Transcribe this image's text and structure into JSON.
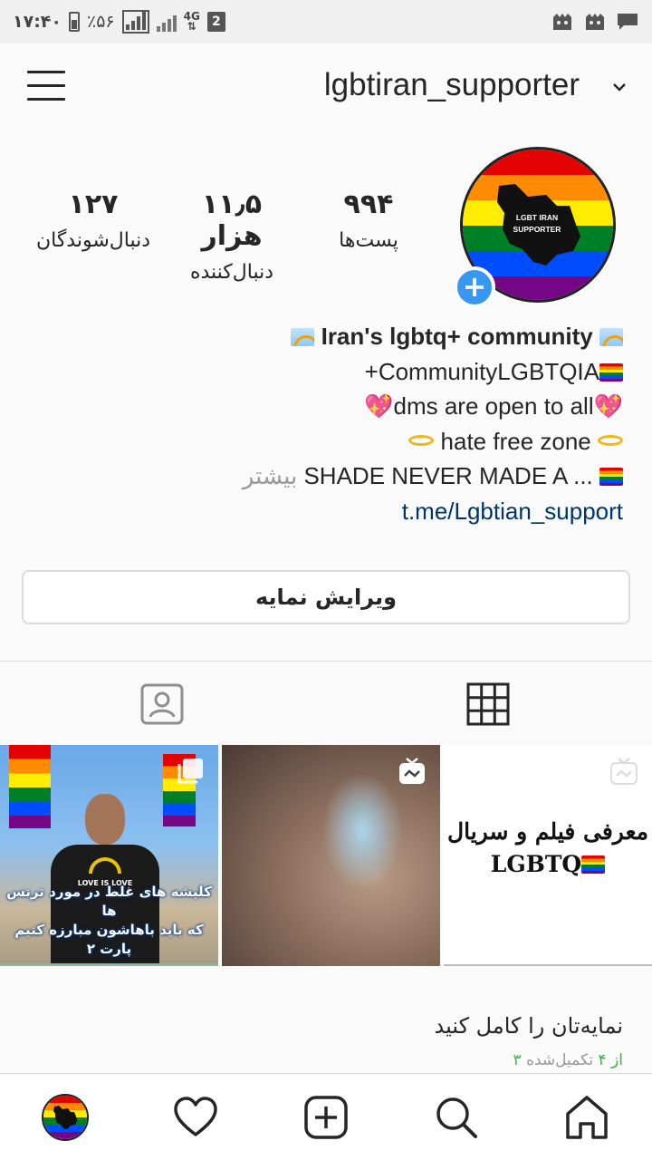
{
  "status_bar": {
    "time": "۱۷:۴۰",
    "battery": "٪۵۶",
    "network": "4G",
    "sim": "2"
  },
  "header": {
    "username": "lgbtiran_supporter"
  },
  "profile": {
    "avatar_text_line1": "LGBT IRAN",
    "avatar_text_line2": "SUPPORTER",
    "stats": {
      "posts_count": "۹۹۴",
      "posts_label": "پست‌ها",
      "followers_count": "۱۱٫۵ هزار",
      "followers_label": "دنبال‌کننده",
      "following_count": "۱۲۷",
      "following_label": "دنبال‌شوندگان"
    },
    "bio": {
      "name": "Iran's lgbtq+ community",
      "line2": "+CommunityLGBTQIA",
      "line3": "dms are open to all",
      "line4": "hate free zone",
      "line5": "SHADE NEVER MADE A ...",
      "more": "بیشتر",
      "link": "t.me/Lgbtian_support"
    },
    "edit_button": "ویرایش نمایه"
  },
  "posts": {
    "post1_caption_line1": "کلیشه های غلط در مورد ترنس ها",
    "post1_caption_line2": "که باید باهاشون مبارزه کنیم",
    "post1_caption_line3": "پارت ۲",
    "post1_shirt_text": "LOVE IS LOVE",
    "post3_line1": "معرفی فیلم و سریال",
    "post3_line2": "LGBTQ"
  },
  "complete_profile": {
    "title": "نمایه‌تان را کامل کنید",
    "progress_green": "۳ از ۴",
    "progress_rest": "تکمیل‌شده"
  },
  "colors": {
    "accent_blue": "#3897f0",
    "link": "#003569",
    "progress_green": "#3ab54a"
  }
}
